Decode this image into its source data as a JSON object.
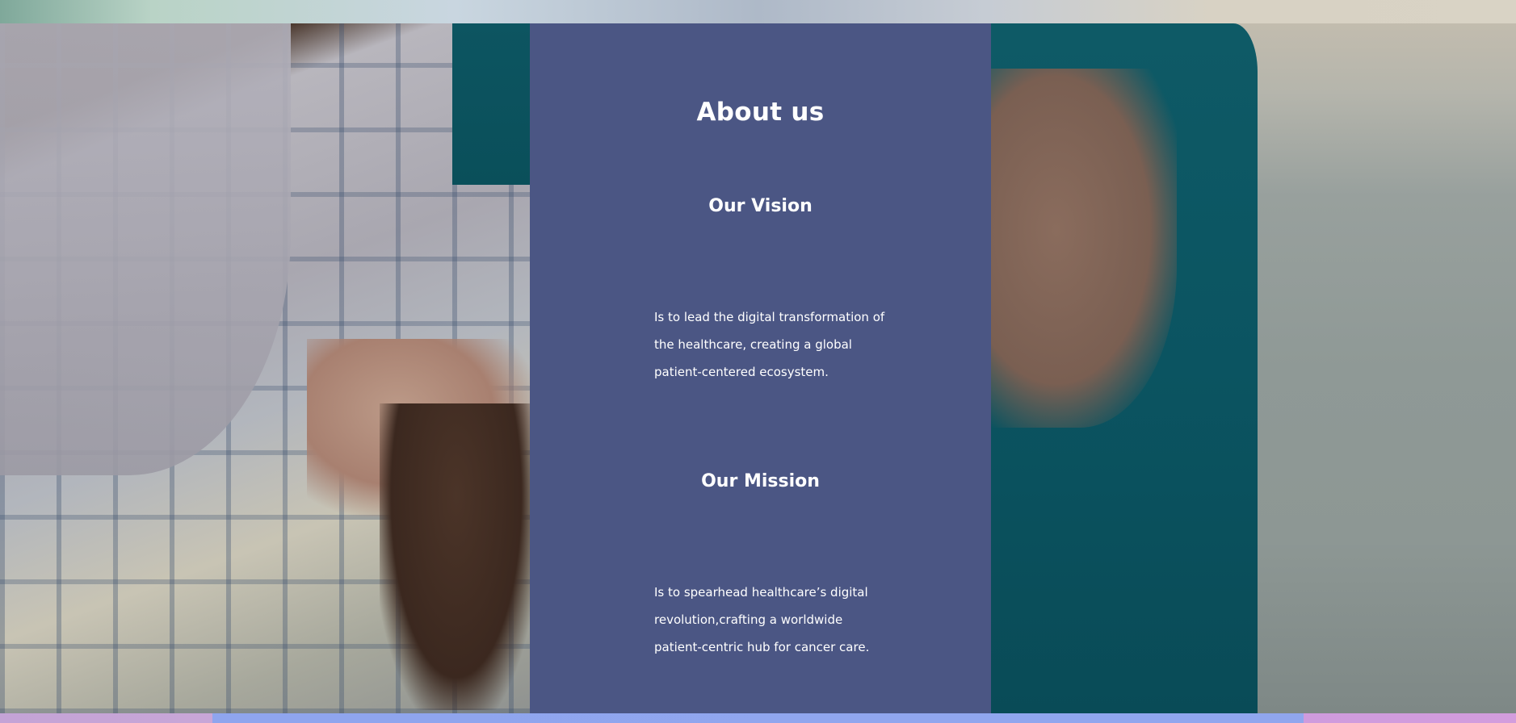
{
  "about": {
    "title": "About us"
  },
  "vision": {
    "heading": "Our Vision",
    "body": "Is to lead the digital transformation of the healthcare, creating a global patient-centered ecosystem."
  },
  "mission": {
    "heading": "Our Mission",
    "body": "Is to spearhead healthcare’s digital revolution,crafting a worldwide patient-centric hub for cancer care."
  },
  "colors": {
    "panel": "#4b5684",
    "text": "#ffffff",
    "bottom_bar_main": "#90a6ee",
    "bottom_bar_accent": "#c8a6d7"
  }
}
